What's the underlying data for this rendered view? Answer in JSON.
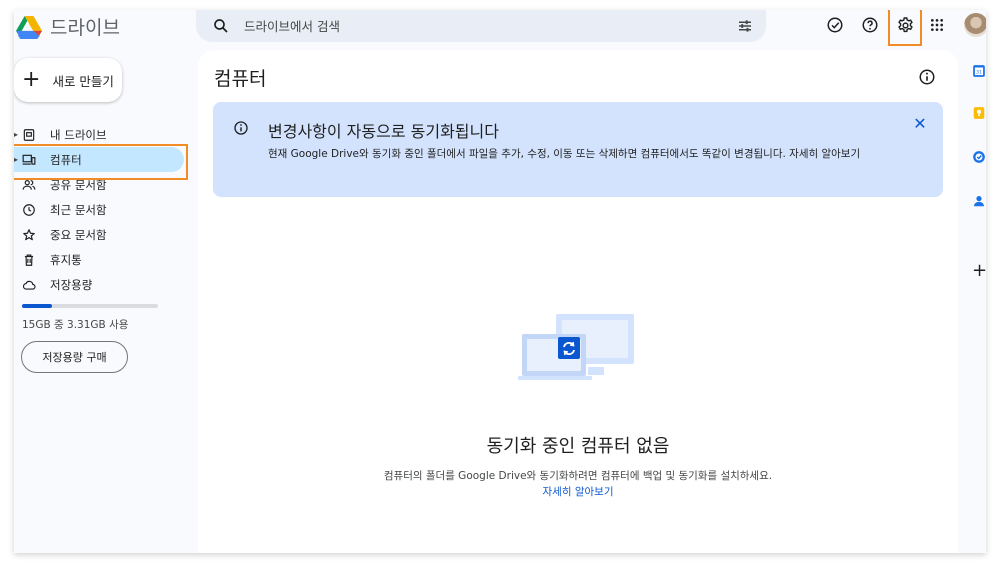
{
  "app": {
    "name": "드라이브"
  },
  "search": {
    "placeholder": "드라이브에서 검색"
  },
  "sidebar": {
    "new_label": "새로 만들기",
    "items": [
      {
        "label": "내 드라이브",
        "icon": "my-drive-icon"
      },
      {
        "label": "컴퓨터",
        "icon": "computer-icon",
        "active": true
      },
      {
        "label": "공유 문서함",
        "icon": "shared-icon"
      },
      {
        "label": "최근 문서함",
        "icon": "clock-icon"
      },
      {
        "label": "중요 문서함",
        "icon": "star-icon"
      },
      {
        "label": "휴지통",
        "icon": "trash-icon"
      },
      {
        "label": "저장용량",
        "icon": "cloud-icon"
      }
    ],
    "storage_text": "15GB 중 3.31GB 사용",
    "storage_fraction": 0.22,
    "buy_label": "저장용량 구매"
  },
  "main": {
    "title": "컴퓨터",
    "banner": {
      "title": "변경사항이 자동으로 동기화됩니다",
      "body": "현재 Google Drive와 동기화 중인 폴더에서 파일을 추가, 수정, 이동 또는 삭제하면 컴퓨터에서도 똑같이 변경됩니다. 자세히 알아보기"
    },
    "empty_title": "동기화 중인 컴퓨터 없음",
    "empty_desc": "컴퓨터의 폴더를 Google Drive와 동기화하려면 컴퓨터에 백업 및 동기화를 설치하세요.",
    "learn_more": "자세히 알아보기"
  },
  "colors": {
    "accent": "#0b57d0",
    "active_bg": "#c2e7ff",
    "banner_bg": "#d3e3fd",
    "highlight": "#f28c28"
  }
}
